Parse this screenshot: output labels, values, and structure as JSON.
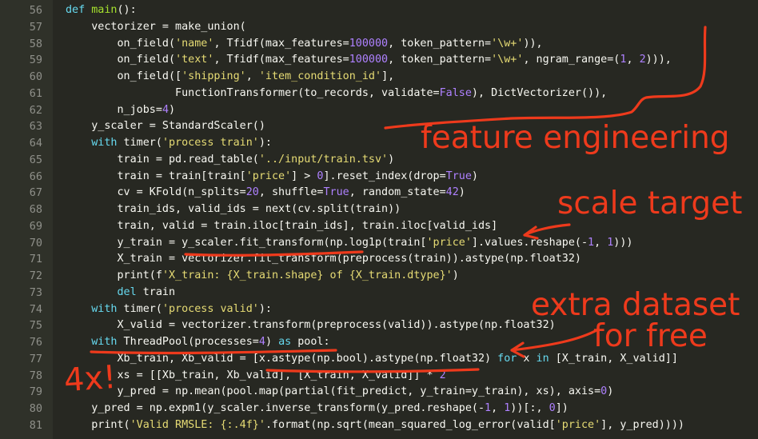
{
  "colors": {
    "background": "#272822",
    "gutter": "#2f3129",
    "line_number": "#8f908a",
    "keyword": "#66d9ef",
    "function": "#a6e22e",
    "string": "#e6db74",
    "number": "#ae81ff",
    "text": "#f8f8f2",
    "annotation": "#ee3a1c"
  },
  "code": {
    "lines": [
      {
        "n": "56",
        "tokens": [
          [
            "kw",
            "def "
          ],
          [
            "fn",
            "main"
          ],
          [
            "tx",
            "():"
          ]
        ]
      },
      {
        "n": "57",
        "tokens": [
          [
            "tx",
            "    vectorizer = make_union("
          ]
        ]
      },
      {
        "n": "58",
        "tokens": [
          [
            "tx",
            "        on_field("
          ],
          [
            "str",
            "'name'"
          ],
          [
            "tx",
            ", Tfidf(max_features="
          ],
          [
            "num",
            "100000"
          ],
          [
            "tx",
            ", token_pattern="
          ],
          [
            "str",
            "'\\w+'"
          ],
          [
            "tx",
            ")),"
          ]
        ]
      },
      {
        "n": "59",
        "tokens": [
          [
            "tx",
            "        on_field("
          ],
          [
            "str",
            "'text'"
          ],
          [
            "tx",
            ", Tfidf(max_features="
          ],
          [
            "num",
            "100000"
          ],
          [
            "tx",
            ", token_pattern="
          ],
          [
            "str",
            "'\\w+'"
          ],
          [
            "tx",
            ", ngram_range=("
          ],
          [
            "num",
            "1"
          ],
          [
            "tx",
            ", "
          ],
          [
            "num",
            "2"
          ],
          [
            "tx",
            "))),"
          ]
        ]
      },
      {
        "n": "60",
        "tokens": [
          [
            "tx",
            "        on_field(["
          ],
          [
            "str",
            "'shipping'"
          ],
          [
            "tx",
            ", "
          ],
          [
            "str",
            "'item_condition_id'"
          ],
          [
            "tx",
            "],"
          ]
        ]
      },
      {
        "n": "61",
        "tokens": [
          [
            "tx",
            "                 FunctionTransformer(to_records, validate="
          ],
          [
            "cn",
            "False"
          ],
          [
            "tx",
            "), DictVectorizer()),"
          ]
        ]
      },
      {
        "n": "62",
        "tokens": [
          [
            "tx",
            "        n_jobs="
          ],
          [
            "num",
            "4"
          ],
          [
            "tx",
            ")"
          ]
        ]
      },
      {
        "n": "63",
        "tokens": [
          [
            "tx",
            "    y_scaler = StandardScaler()"
          ]
        ]
      },
      {
        "n": "64",
        "tokens": [
          [
            "tx",
            "    "
          ],
          [
            "kw",
            "with"
          ],
          [
            "tx",
            " timer("
          ],
          [
            "str",
            "'process train'"
          ],
          [
            "tx",
            "):"
          ]
        ]
      },
      {
        "n": "65",
        "tokens": [
          [
            "tx",
            "        train = pd.read_table("
          ],
          [
            "str",
            "'../input/train.tsv'"
          ],
          [
            "tx",
            ")"
          ]
        ]
      },
      {
        "n": "66",
        "tokens": [
          [
            "tx",
            "        train = train[train["
          ],
          [
            "str",
            "'price'"
          ],
          [
            "tx",
            "] > "
          ],
          [
            "num",
            "0"
          ],
          [
            "tx",
            "].reset_index(drop="
          ],
          [
            "cn",
            "True"
          ],
          [
            "tx",
            ")"
          ]
        ]
      },
      {
        "n": "67",
        "tokens": [
          [
            "tx",
            "        cv = KFold(n_splits="
          ],
          [
            "num",
            "20"
          ],
          [
            "tx",
            ", shuffle="
          ],
          [
            "cn",
            "True"
          ],
          [
            "tx",
            ", random_state="
          ],
          [
            "num",
            "42"
          ],
          [
            "tx",
            ")"
          ]
        ]
      },
      {
        "n": "68",
        "tokens": [
          [
            "tx",
            "        train_ids, valid_ids = next(cv.split(train))"
          ]
        ]
      },
      {
        "n": "69",
        "tokens": [
          [
            "tx",
            "        train, valid = train.iloc[train_ids], train.iloc[valid_ids]"
          ]
        ]
      },
      {
        "n": "70",
        "tokens": [
          [
            "tx",
            "        y_train = y_scaler.fit_transform(np.log1p(train["
          ],
          [
            "str",
            "'price'"
          ],
          [
            "tx",
            "].values.reshape(-"
          ],
          [
            "num",
            "1"
          ],
          [
            "tx",
            ", "
          ],
          [
            "num",
            "1"
          ],
          [
            "tx",
            ")))"
          ]
        ]
      },
      {
        "n": "71",
        "tokens": [
          [
            "tx",
            "        X_train = vectorizer.fit_transform(preprocess(train)).astype(np.float32)"
          ]
        ]
      },
      {
        "n": "72",
        "tokens": [
          [
            "tx",
            "        print(f"
          ],
          [
            "str",
            "'X_train: {X_train.shape} of {X_train.dtype}'"
          ],
          [
            "tx",
            ")"
          ]
        ]
      },
      {
        "n": "73",
        "tokens": [
          [
            "tx",
            "        "
          ],
          [
            "kw",
            "del"
          ],
          [
            "tx",
            " train"
          ]
        ]
      },
      {
        "n": "74",
        "tokens": [
          [
            "tx",
            "    "
          ],
          [
            "kw",
            "with"
          ],
          [
            "tx",
            " timer("
          ],
          [
            "str",
            "'process valid'"
          ],
          [
            "tx",
            "):"
          ]
        ]
      },
      {
        "n": "75",
        "tokens": [
          [
            "tx",
            "        X_valid = vectorizer.transform(preprocess(valid)).astype(np.float32)"
          ]
        ]
      },
      {
        "n": "76",
        "tokens": [
          [
            "tx",
            "    "
          ],
          [
            "kw",
            "with"
          ],
          [
            "tx",
            " ThreadPool(processes="
          ],
          [
            "num",
            "4"
          ],
          [
            "tx",
            ") "
          ],
          [
            "kw",
            "as"
          ],
          [
            "tx",
            " pool:"
          ]
        ]
      },
      {
        "n": "77",
        "tokens": [
          [
            "tx",
            "        Xb_train, Xb_valid = [x.astype(np.bool).astype(np.float32) "
          ],
          [
            "kw",
            "for"
          ],
          [
            "tx",
            " x "
          ],
          [
            "kw",
            "in"
          ],
          [
            "tx",
            " [X_train, X_valid]]"
          ]
        ]
      },
      {
        "n": "78",
        "tokens": [
          [
            "tx",
            "        xs = [[Xb_train, Xb_valid], [X_train, X_valid]] * "
          ],
          [
            "num",
            "2"
          ]
        ]
      },
      {
        "n": "79",
        "tokens": [
          [
            "tx",
            "        y_pred = np.mean(pool.map(partial(fit_predict, y_train=y_train), xs), axis="
          ],
          [
            "num",
            "0"
          ],
          [
            "tx",
            ")"
          ]
        ]
      },
      {
        "n": "80",
        "tokens": [
          [
            "tx",
            "    y_pred = np.expm1(y_scaler.inverse_transform(y_pred.reshape(-"
          ],
          [
            "num",
            "1"
          ],
          [
            "tx",
            ", "
          ],
          [
            "num",
            "1"
          ],
          [
            "tx",
            "))[:, "
          ],
          [
            "num",
            "0"
          ],
          [
            "tx",
            "])"
          ]
        ]
      },
      {
        "n": "81",
        "tokens": [
          [
            "tx",
            "    print("
          ],
          [
            "str",
            "'Valid RMSLE: {:.4f}'"
          ],
          [
            "tx",
            ".format(np.sqrt(mean_squared_log_error(valid["
          ],
          [
            "str",
            "'price'"
          ],
          [
            "tx",
            "], y_pred))))"
          ]
        ]
      }
    ]
  },
  "annotations": {
    "feature_engineering": "feature engineering",
    "scale_target": "scale target",
    "extra_dataset_line1": "extra dataset",
    "extra_dataset_line2": "for free",
    "four_x": "4x!"
  }
}
